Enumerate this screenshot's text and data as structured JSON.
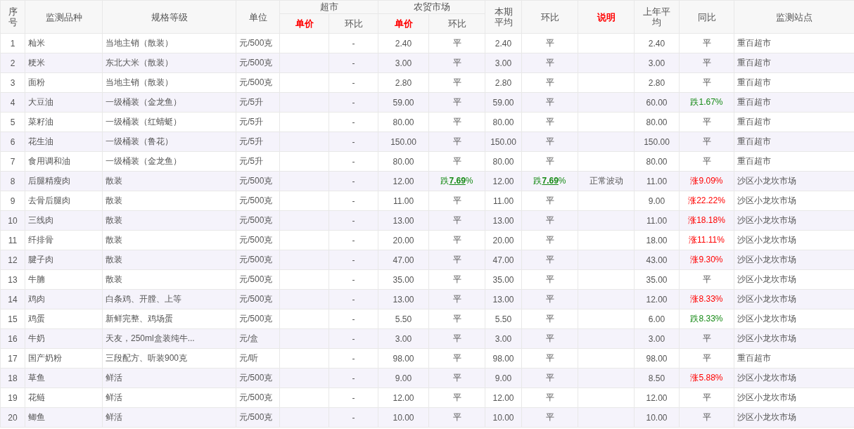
{
  "columns": [
    {
      "label": "序号",
      "highlight": false
    },
    {
      "label": "监测品种",
      "highlight": false
    },
    {
      "label": "规格等级",
      "highlight": false
    },
    {
      "label": "单位",
      "highlight": false
    },
    {
      "label": "超市",
      "highlight": false,
      "children": [
        {
          "label": "单价",
          "highlight": true
        },
        {
          "label": "环比",
          "highlight": false
        }
      ]
    },
    {
      "label": "农贸市场",
      "highlight": false,
      "children": [
        {
          "label": "单价",
          "highlight": true
        },
        {
          "label": "环比",
          "highlight": false
        }
      ]
    },
    {
      "label": "本期平均",
      "highlight": false
    },
    {
      "label": "环比",
      "highlight": false
    },
    {
      "label": "说明",
      "highlight": true
    },
    {
      "label": "上年平均",
      "highlight": false
    },
    {
      "label": "同比",
      "highlight": false
    },
    {
      "label": "监测站点",
      "highlight": false
    }
  ],
  "rows": [
    {
      "no": "1",
      "item": "籼米",
      "spec": "当地主销（散装）",
      "unit": "元/500克",
      "super_change": "-",
      "market_price": "2.40",
      "market_change": {
        "text": "平",
        "kind": "flat"
      },
      "avg": "2.40",
      "avg_change": {
        "text": "平",
        "kind": "flat"
      },
      "last_year_avg": "2.40",
      "yoy": {
        "text": "平",
        "kind": "flat"
      },
      "station": "重百超市"
    },
    {
      "no": "2",
      "item": "粳米",
      "spec": "东北大米（散装）",
      "unit": "元/500克",
      "super_change": "-",
      "market_price": "3.00",
      "market_change": {
        "text": "平",
        "kind": "flat"
      },
      "avg": "3.00",
      "avg_change": {
        "text": "平",
        "kind": "flat"
      },
      "last_year_avg": "3.00",
      "yoy": {
        "text": "平",
        "kind": "flat"
      },
      "station": "重百超市"
    },
    {
      "no": "3",
      "item": "面粉",
      "spec": "当地主销（散装）",
      "unit": "元/500克",
      "super_change": "-",
      "market_price": "2.80",
      "market_change": {
        "text": "平",
        "kind": "flat"
      },
      "avg": "2.80",
      "avg_change": {
        "text": "平",
        "kind": "flat"
      },
      "last_year_avg": "2.80",
      "yoy": {
        "text": "平",
        "kind": "flat"
      },
      "station": "重百超市"
    },
    {
      "no": "4",
      "item": "大豆油",
      "spec": "一级桶装（金龙鱼）",
      "unit": "元/5升",
      "super_change": "-",
      "market_price": "59.00",
      "market_change": {
        "text": "平",
        "kind": "flat"
      },
      "avg": "59.00",
      "avg_change": {
        "text": "平",
        "kind": "flat"
      },
      "last_year_avg": "60.00",
      "yoy": {
        "text": "跌1.67%",
        "kind": "down"
      },
      "station": "重百超市"
    },
    {
      "no": "5",
      "item": "菜籽油",
      "spec": "一级桶装（红蜻蜓）",
      "unit": "元/5升",
      "super_change": "-",
      "market_price": "80.00",
      "market_change": {
        "text": "平",
        "kind": "flat"
      },
      "avg": "80.00",
      "avg_change": {
        "text": "平",
        "kind": "flat"
      },
      "last_year_avg": "80.00",
      "yoy": {
        "text": "平",
        "kind": "flat"
      },
      "station": "重百超市"
    },
    {
      "no": "6",
      "item": "花生油",
      "spec": "一级桶装（鲁花）",
      "unit": "元/5升",
      "super_change": "-",
      "market_price": "150.00",
      "market_change": {
        "text": "平",
        "kind": "flat"
      },
      "avg": "150.00",
      "avg_change": {
        "text": "平",
        "kind": "flat"
      },
      "last_year_avg": "150.00",
      "yoy": {
        "text": "平",
        "kind": "flat"
      },
      "station": "重百超市"
    },
    {
      "no": "7",
      "item": "食用调和油",
      "spec": "一级桶装（金龙鱼）",
      "unit": "元/5升",
      "super_change": "-",
      "market_price": "80.00",
      "market_change": {
        "text": "平",
        "kind": "flat"
      },
      "avg": "80.00",
      "avg_change": {
        "text": "平",
        "kind": "flat"
      },
      "last_year_avg": "80.00",
      "yoy": {
        "text": "平",
        "kind": "flat"
      },
      "station": "重百超市"
    },
    {
      "no": "8",
      "item": "后腿精瘦肉",
      "spec": "散装",
      "unit": "元/500克",
      "super_change": "-",
      "market_price": "12.00",
      "market_change": {
        "text": "跌**7.69**%",
        "kind": "down"
      },
      "avg": "12.00",
      "avg_change": {
        "text": "跌**7.69**%",
        "kind": "down"
      },
      "note": "正常波动",
      "last_year_avg": "11.00",
      "yoy": {
        "text": "涨9.09%",
        "kind": "up"
      },
      "station": "沙区小龙坎市场"
    },
    {
      "no": "9",
      "item": "去骨后腿肉",
      "spec": "散装",
      "unit": "元/500克",
      "super_change": "-",
      "market_price": "11.00",
      "market_change": {
        "text": "平",
        "kind": "flat"
      },
      "avg": "11.00",
      "avg_change": {
        "text": "平",
        "kind": "flat"
      },
      "last_year_avg": "9.00",
      "yoy": {
        "text": "涨22.22%",
        "kind": "up"
      },
      "station": "沙区小龙坎市场"
    },
    {
      "no": "10",
      "item": "三线肉",
      "spec": "散装",
      "unit": "元/500克",
      "super_change": "-",
      "market_price": "13.00",
      "market_change": {
        "text": "平",
        "kind": "flat"
      },
      "avg": "13.00",
      "avg_change": {
        "text": "平",
        "kind": "flat"
      },
      "last_year_avg": "11.00",
      "yoy": {
        "text": "涨18.18%",
        "kind": "up"
      },
      "station": "沙区小龙坎市场"
    },
    {
      "no": "11",
      "item": "纤排骨",
      "spec": "散装",
      "unit": "元/500克",
      "super_change": "-",
      "market_price": "20.00",
      "market_change": {
        "text": "平",
        "kind": "flat"
      },
      "avg": "20.00",
      "avg_change": {
        "text": "平",
        "kind": "flat"
      },
      "last_year_avg": "18.00",
      "yoy": {
        "text": "涨11.11%",
        "kind": "up"
      },
      "station": "沙区小龙坎市场"
    },
    {
      "no": "12",
      "item": "腱子肉",
      "spec": "散装",
      "unit": "元/500克",
      "super_change": "-",
      "market_price": "47.00",
      "market_change": {
        "text": "平",
        "kind": "flat"
      },
      "avg": "47.00",
      "avg_change": {
        "text": "平",
        "kind": "flat"
      },
      "last_year_avg": "43.00",
      "yoy": {
        "text": "涨9.30%",
        "kind": "up"
      },
      "station": "沙区小龙坎市场"
    },
    {
      "no": "13",
      "item": "牛腩",
      "spec": "散装",
      "unit": "元/500克",
      "super_change": "-",
      "market_price": "35.00",
      "market_change": {
        "text": "平",
        "kind": "flat"
      },
      "avg": "35.00",
      "avg_change": {
        "text": "平",
        "kind": "flat"
      },
      "last_year_avg": "35.00",
      "yoy": {
        "text": "平",
        "kind": "flat"
      },
      "station": "沙区小龙坎市场"
    },
    {
      "no": "14",
      "item": "鸡肉",
      "spec": "白条鸡、开膛、上等",
      "unit": "元/500克",
      "super_change": "-",
      "market_price": "13.00",
      "market_change": {
        "text": "平",
        "kind": "flat"
      },
      "avg": "13.00",
      "avg_change": {
        "text": "平",
        "kind": "flat"
      },
      "last_year_avg": "12.00",
      "yoy": {
        "text": "涨8.33%",
        "kind": "up"
      },
      "station": "沙区小龙坎市场"
    },
    {
      "no": "15",
      "item": "鸡蛋",
      "spec": "新鲜完整、鸡场蛋",
      "unit": "元/500克",
      "super_change": "-",
      "market_price": "5.50",
      "market_change": {
        "text": "平",
        "kind": "flat"
      },
      "avg": "5.50",
      "avg_change": {
        "text": "平",
        "kind": "flat"
      },
      "last_year_avg": "6.00",
      "yoy": {
        "text": "跌8.33%",
        "kind": "down"
      },
      "station": "沙区小龙坎市场"
    },
    {
      "no": "16",
      "item": "牛奶",
      "spec": "天友，250ml盒装纯牛...",
      "unit": "元/盒",
      "super_change": "-",
      "market_price": "3.00",
      "market_change": {
        "text": "平",
        "kind": "flat"
      },
      "avg": "3.00",
      "avg_change": {
        "text": "平",
        "kind": "flat"
      },
      "last_year_avg": "3.00",
      "yoy": {
        "text": "平",
        "kind": "flat"
      },
      "station": "沙区小龙坎市场"
    },
    {
      "no": "17",
      "item": "国产奶粉",
      "spec": "三段配方、听装900克",
      "unit": "元/听",
      "super_change": "-",
      "market_price": "98.00",
      "market_change": {
        "text": "平",
        "kind": "flat"
      },
      "avg": "98.00",
      "avg_change": {
        "text": "平",
        "kind": "flat"
      },
      "last_year_avg": "98.00",
      "yoy": {
        "text": "平",
        "kind": "flat"
      },
      "station": "重百超市"
    },
    {
      "no": "18",
      "item": "草鱼",
      "spec": "鲜活",
      "unit": "元/500克",
      "super_change": "-",
      "market_price": "9.00",
      "market_change": {
        "text": "平",
        "kind": "flat"
      },
      "avg": "9.00",
      "avg_change": {
        "text": "平",
        "kind": "flat"
      },
      "last_year_avg": "8.50",
      "yoy": {
        "text": "涨5.88%",
        "kind": "up"
      },
      "station": "沙区小龙坎市场"
    },
    {
      "no": "19",
      "item": "花鲢",
      "spec": "鲜活",
      "unit": "元/500克",
      "super_change": "-",
      "market_price": "12.00",
      "market_change": {
        "text": "平",
        "kind": "flat"
      },
      "avg": "12.00",
      "avg_change": {
        "text": "平",
        "kind": "flat"
      },
      "last_year_avg": "12.00",
      "yoy": {
        "text": "平",
        "kind": "flat"
      },
      "station": "沙区小龙坎市场"
    },
    {
      "no": "20",
      "item": "鲫鱼",
      "spec": "鲜活",
      "unit": "元/500克",
      "super_change": "-",
      "market_price": "10.00",
      "market_change": {
        "text": "平",
        "kind": "flat"
      },
      "avg": "10.00",
      "avg_change": {
        "text": "平",
        "kind": "flat"
      },
      "last_year_avg": "10.00",
      "yoy": {
        "text": "平",
        "kind": "flat"
      },
      "station": "沙区小龙坎市场"
    }
  ]
}
